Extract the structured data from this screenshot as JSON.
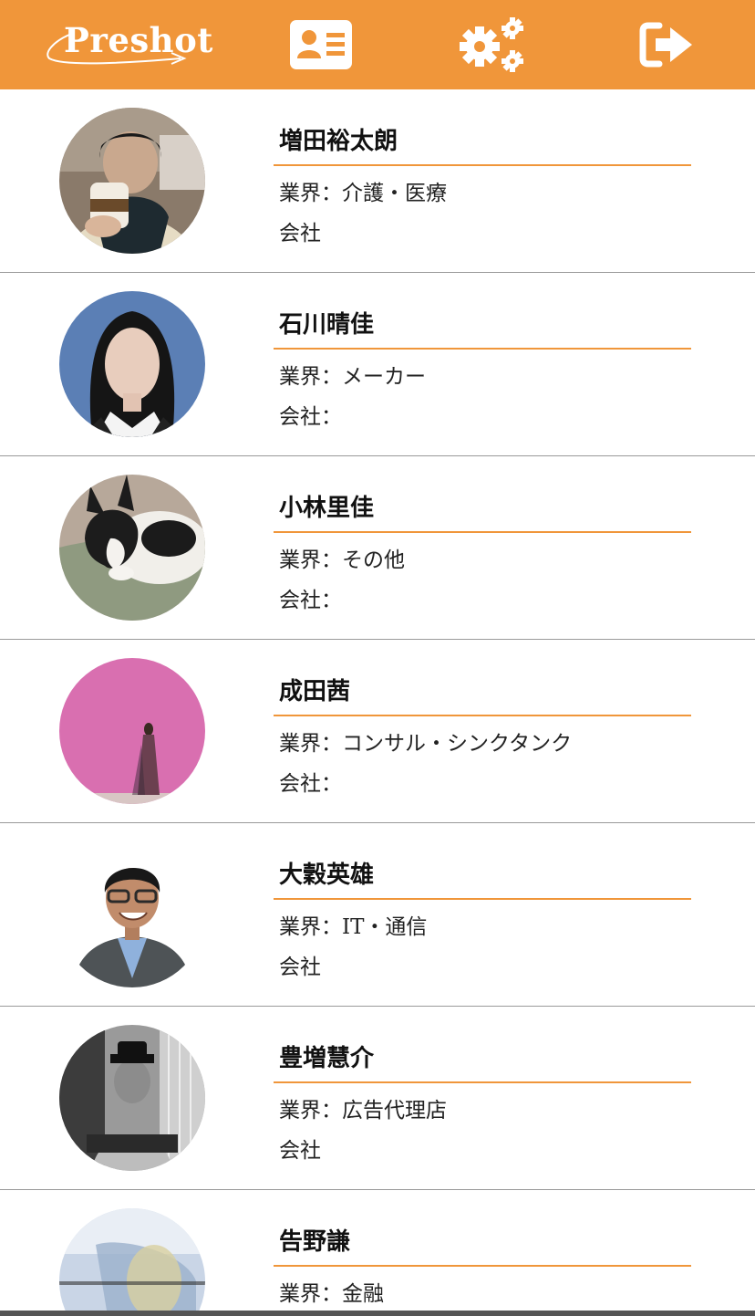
{
  "app": {
    "logo_text": "Preshot",
    "accent_color": "#f0963a"
  },
  "header": {
    "icons": {
      "profile": "id-card-icon",
      "settings": "gears-icon",
      "logout": "sign-out-icon"
    }
  },
  "users": [
    {
      "name": "増田裕太朗",
      "industry": "業界：介護・医療",
      "company": "会社"
    },
    {
      "name": "石川晴佳",
      "industry": "業界：メーカー",
      "company": "会社："
    },
    {
      "name": "小林里佳",
      "industry": "業界：その他",
      "company": "会社："
    },
    {
      "name": "成田茜",
      "industry": "業界：コンサル・シンクタンク",
      "company": "会社："
    },
    {
      "name": "大穀英雄",
      "industry": "業界：IT・通信",
      "company": "会社"
    },
    {
      "name": "豊増慧介",
      "industry": "業界：広告代理店",
      "company": "会社"
    },
    {
      "name": "告野謙",
      "industry": "業界：金融",
      "company": ""
    }
  ]
}
